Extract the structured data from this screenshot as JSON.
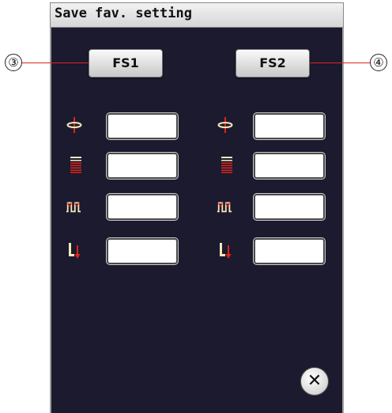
{
  "window": {
    "title": "Save fav. setting"
  },
  "buttons": {
    "fs1_label": "FS1",
    "fs2_label": "FS2"
  },
  "callouts": {
    "left": "③",
    "right": "④"
  },
  "rows": [
    {
      "icon": "thread-tension-icon",
      "left_value": "",
      "right_value": ""
    },
    {
      "icon": "stitch-length-icon",
      "left_value": "",
      "right_value": ""
    },
    {
      "icon": "stitch-width-icon",
      "left_value": "",
      "right_value": ""
    },
    {
      "icon": "presser-foot-pressure-icon",
      "left_value": "",
      "right_value": ""
    }
  ],
  "close": {
    "label": "✕",
    "icon": "close-icon"
  },
  "colors": {
    "panel": "#1b1a2e",
    "accent_red": "#e2231a",
    "icon_cream": "#f3e7bd"
  }
}
